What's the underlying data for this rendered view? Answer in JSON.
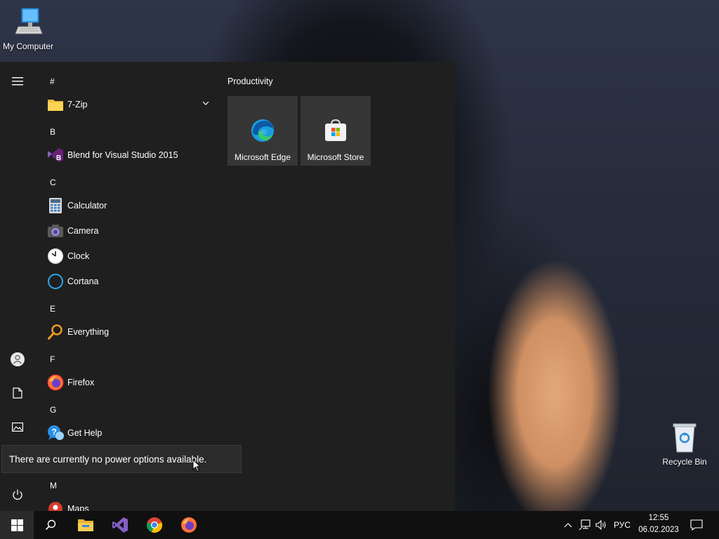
{
  "desktop": {
    "icons": [
      {
        "label": "My Computer",
        "icon": "computer-icon"
      },
      {
        "label": "Recycle Bin",
        "icon": "recycle-bin-icon"
      }
    ]
  },
  "start_menu": {
    "rail": [
      {
        "icon": "hamburger-menu-icon"
      },
      {
        "icon": "user-icon"
      },
      {
        "icon": "documents-icon"
      },
      {
        "icon": "pictures-icon"
      },
      {
        "icon": "power-icon"
      }
    ],
    "groups": {
      "hash": "#",
      "b": "B",
      "c": "C",
      "e": "E",
      "f": "F",
      "g": "G",
      "m": "M"
    },
    "apps": {
      "zip": "7-Zip",
      "blend": "Blend for Visual Studio 2015",
      "calculator": "Calculator",
      "camera": "Camera",
      "clock": "Clock",
      "cortana": "Cortana",
      "everything": "Everything",
      "firefox": "Firefox",
      "gethelp": "Get Help",
      "maps": "Maps"
    },
    "tiles_section": {
      "title": "Productivity",
      "tiles": [
        {
          "label": "Microsoft Edge",
          "icon": "edge-icon"
        },
        {
          "label": "Microsoft Store",
          "icon": "store-icon"
        }
      ]
    },
    "power_tooltip": "There are currently no power options available."
  },
  "taskbar": {
    "pinned": [
      "start-icon",
      "search-icon",
      "file-explorer-icon",
      "visual-studio-icon",
      "chrome-icon",
      "firefox-icon"
    ],
    "tray": {
      "language": "РУС",
      "time": "12:55",
      "date": "06.02.2023"
    }
  },
  "colors": {
    "start_bg": "#1f1f1f",
    "tile_bg": "#363636",
    "taskbar_bg": "#101010",
    "tooltip_bg": "#2b2b2b"
  }
}
